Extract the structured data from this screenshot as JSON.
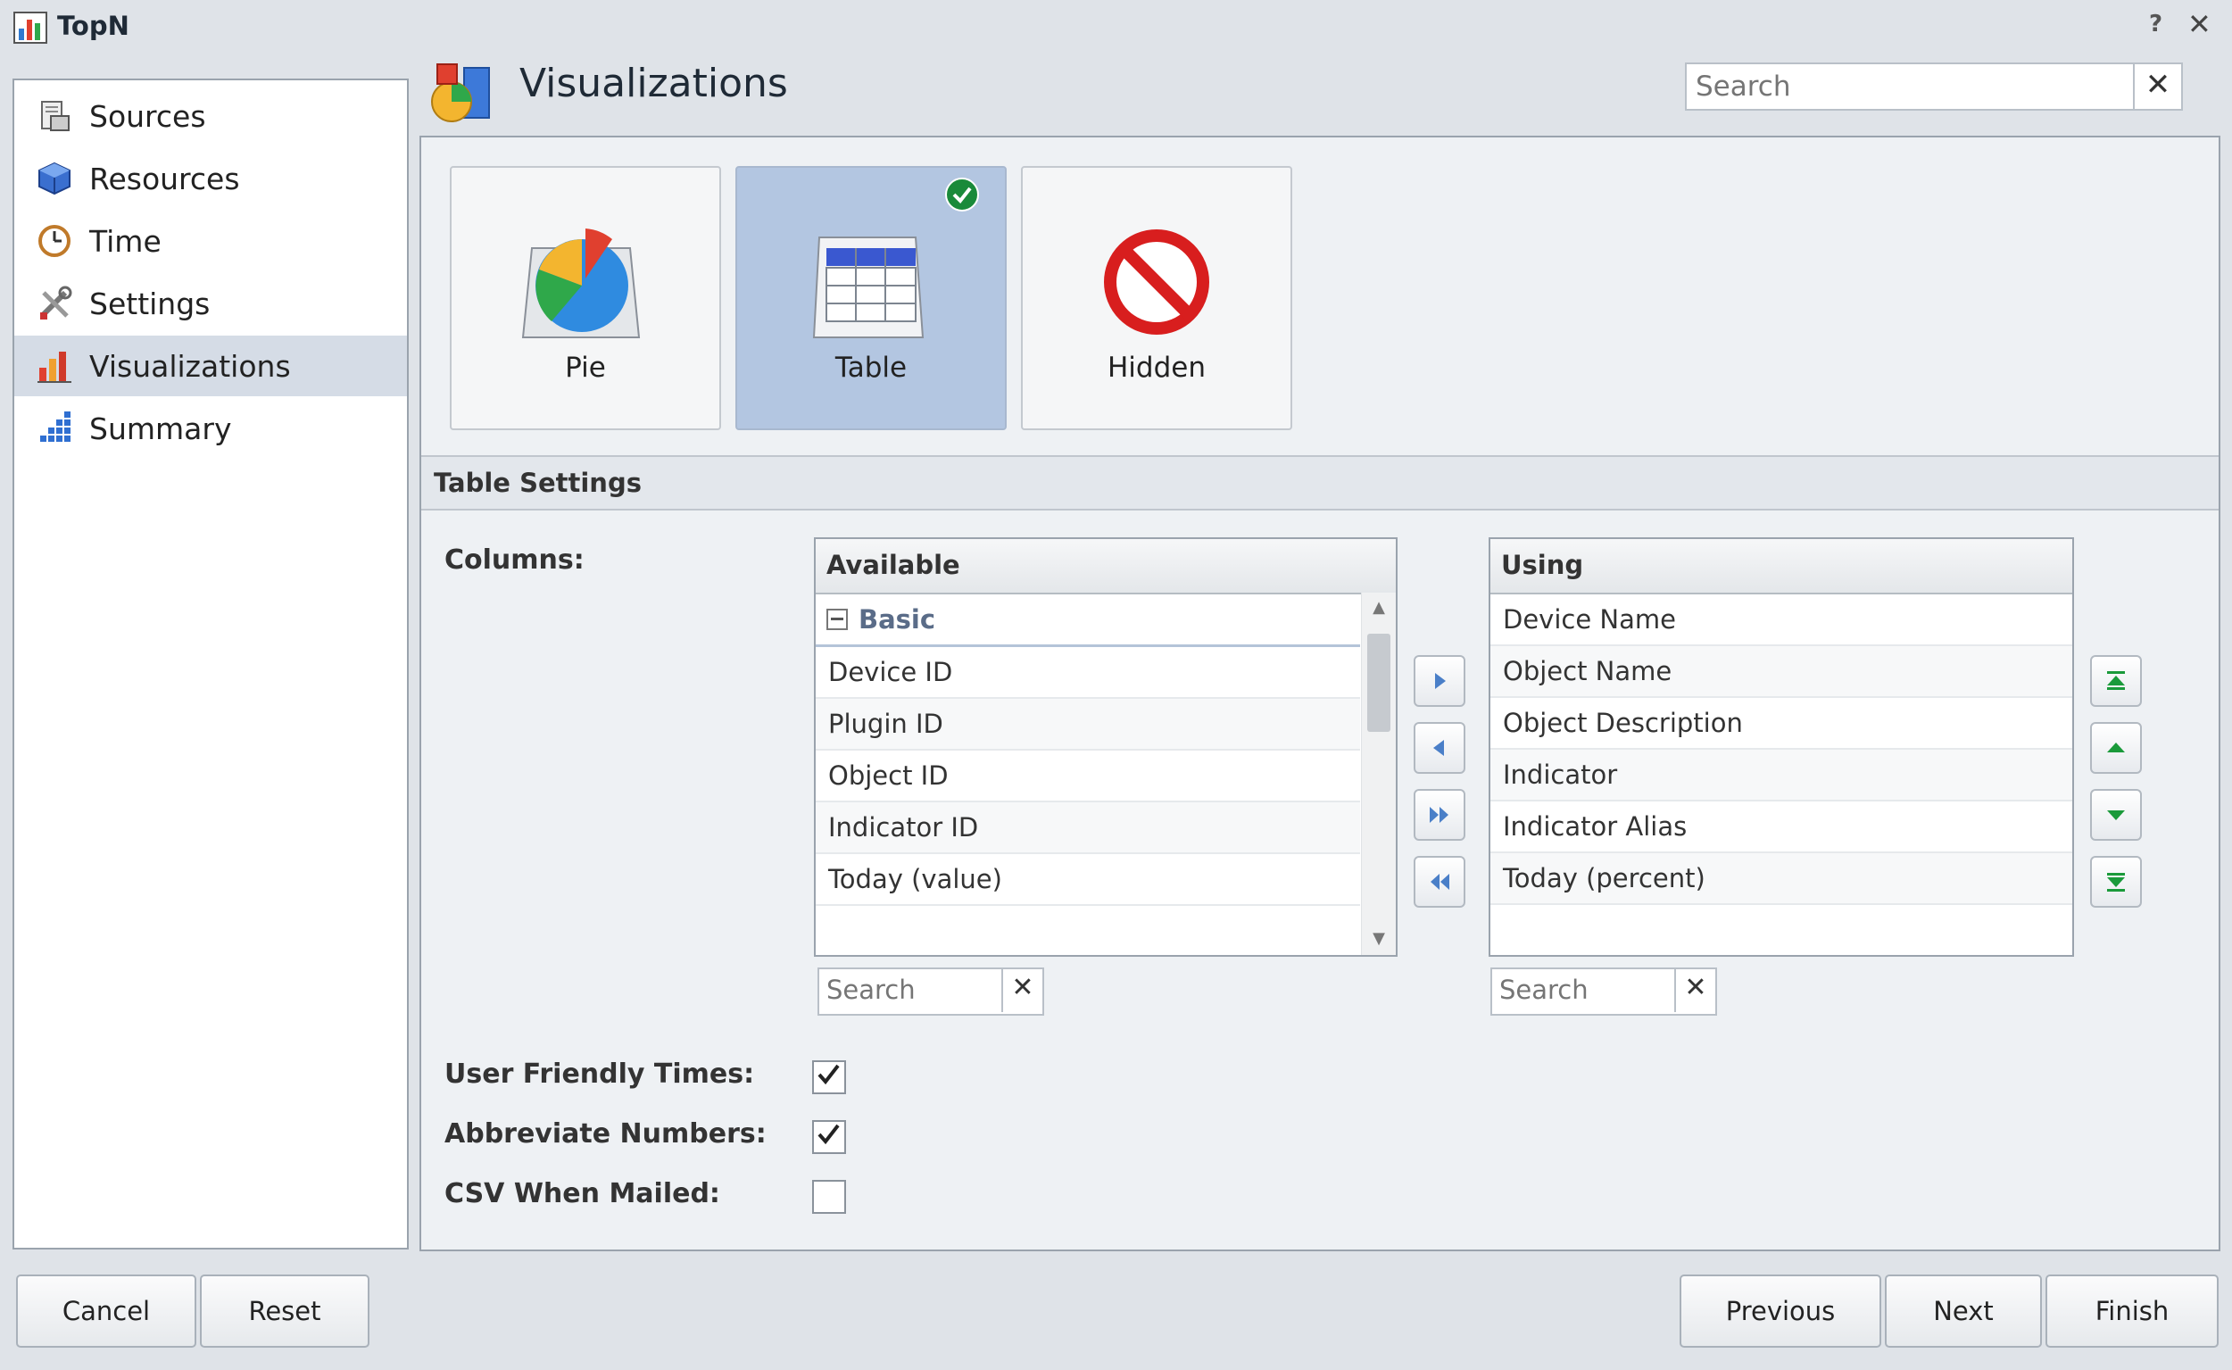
{
  "window": {
    "title": "TopN",
    "help_label": "?",
    "close_label": "✕"
  },
  "sidebar": {
    "items": [
      {
        "label": "Sources",
        "icon": "sources-icon"
      },
      {
        "label": "Resources",
        "icon": "resources-icon"
      },
      {
        "label": "Time",
        "icon": "clock-icon"
      },
      {
        "label": "Settings",
        "icon": "tools-icon"
      },
      {
        "label": "Visualizations",
        "icon": "bar-chart-icon",
        "active": true
      },
      {
        "label": "Summary",
        "icon": "summary-icon"
      }
    ]
  },
  "header": {
    "title": "Visualizations",
    "search_placeholder": "Search",
    "clear_label": "✕"
  },
  "visualizations": {
    "options": [
      {
        "label": "Pie",
        "selected": false
      },
      {
        "label": "Table",
        "selected": true
      },
      {
        "label": "Hidden",
        "selected": false
      }
    ]
  },
  "table_settings": {
    "title": "Table Settings",
    "columns_label": "Columns:",
    "available": {
      "header": "Available",
      "group": "Basic",
      "items": [
        "Device ID",
        "Plugin ID",
        "Object ID",
        "Indicator ID",
        "Today (value)"
      ],
      "search_placeholder": "Search",
      "clear_label": "✕"
    },
    "using": {
      "header": "Using",
      "items": [
        "Device Name",
        "Object Name",
        "Object Description",
        "Indicator",
        "Indicator Alias",
        "Today (percent)"
      ],
      "search_placeholder": "Search",
      "clear_label": "✕"
    },
    "options": [
      {
        "label": "User Friendly Times:",
        "checked": true
      },
      {
        "label": "Abbreviate Numbers:",
        "checked": true
      },
      {
        "label": "CSV When Mailed:",
        "checked": false
      }
    ]
  },
  "footer": {
    "cancel": "Cancel",
    "reset": "Reset",
    "previous": "Previous",
    "next": "Next",
    "finish": "Finish"
  },
  "colors": {
    "accent": "#d5dce6",
    "selected_card": "#b3c6e1",
    "check_green": "#1a8a3a"
  }
}
